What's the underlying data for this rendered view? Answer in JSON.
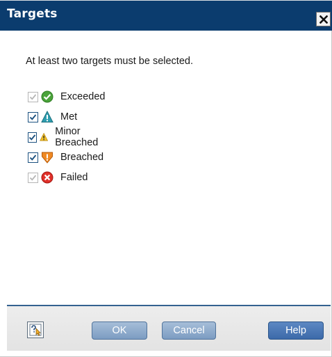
{
  "dialog": {
    "title": "Targets",
    "message": "At least two targets must be selected."
  },
  "options": [
    {
      "label": "Exceeded",
      "checked": true,
      "enabled": false,
      "icon": "check-circle-green-icon",
      "color": "#4aa33a"
    },
    {
      "label": "Met",
      "checked": true,
      "enabled": true,
      "icon": "warning-triangle-teal-icon",
      "color": "#2f9fb0"
    },
    {
      "label": "Minor Breached",
      "checked": true,
      "enabled": true,
      "icon": "warning-triangle-yellow-icon",
      "color": "#f2c22b"
    },
    {
      "label": "Breached",
      "checked": true,
      "enabled": true,
      "icon": "exclamation-shield-orange-icon",
      "color": "#f08a24"
    },
    {
      "label": "Failed",
      "checked": true,
      "enabled": false,
      "icon": "x-circle-red-icon",
      "color": "#e0302a"
    }
  ],
  "buttons": {
    "ok": "OK",
    "cancel": "Cancel",
    "help": "Help"
  },
  "colors": {
    "titlebar": "#0b3c6e",
    "button": "#7c9cc2",
    "help_button": "#3c6aa9",
    "footer": "#e6e6e6"
  }
}
